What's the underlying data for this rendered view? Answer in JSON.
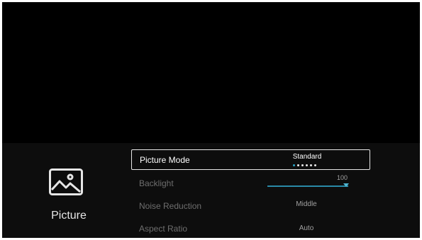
{
  "category": {
    "label": "Picture",
    "icon": "picture-icon"
  },
  "settings": [
    {
      "label": "Picture Mode",
      "value": "Standard",
      "option_count": 6,
      "selected_option": 1
    },
    {
      "label": "Backlight",
      "value": "100",
      "level": 100
    },
    {
      "label": "Noise Reduction",
      "value": "Middle"
    },
    {
      "label": "Aspect Ratio",
      "value": "Auto"
    }
  ],
  "colors": {
    "accent": "#2aa6c8",
    "background": "#000000",
    "panel": "#0d0d0d"
  }
}
